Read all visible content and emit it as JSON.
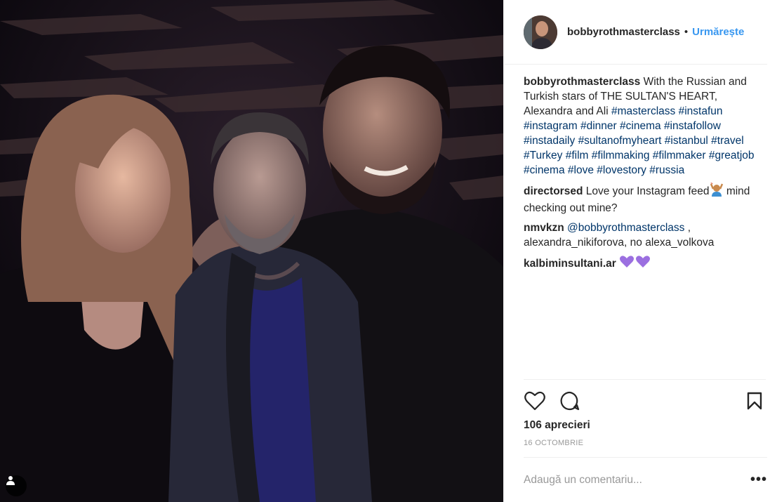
{
  "post": {
    "username": "bobbyrothmasterclass",
    "follow_label": "Urmărește",
    "separator": "•"
  },
  "caption": {
    "username": "bobbyrothmasterclass",
    "text": "With the Russian and Turkish stars of THE SULTAN'S HEART, Alexandra and Ali",
    "hashtags": [
      "#masterclass",
      "#instafun",
      "#instagram",
      "#dinner",
      "#cinema",
      "#instafollow",
      "#instadaily",
      "#sultanofmyheart",
      "#istanbul",
      "#travel",
      "#Turkey",
      "#film",
      "#filmmaking",
      "#filmmaker",
      "#greatjob",
      "#cinema",
      "#love",
      "#lovestory",
      "#russia"
    ]
  },
  "comments": [
    {
      "username": "directorsed",
      "text_a": "Love your Instagram feed",
      "text_b": "mind checking out mine?",
      "emoji": "person-raising-hands-emoji"
    },
    {
      "username": "nmvkzn",
      "mention": "@bobbyrothmasterclass",
      "text": ", alexandra_nikiforova, no alexa_volkova"
    },
    {
      "username": "kalbiminsultani.ar",
      "emoji": "purple-hearts-emoji"
    }
  ],
  "likes_label": "106 aprecieri",
  "date_label": "16 OCTOMBRIE",
  "comment_input": {
    "placeholder": "Adaugă un comentariu..."
  },
  "icons": [
    "heart-icon",
    "comment-icon",
    "bookmark-icon",
    "more-options-icon",
    "user-tag-icon"
  ],
  "colors": {
    "accent": "#3897f0",
    "hashtag": "#003569",
    "muted": "#999999"
  }
}
